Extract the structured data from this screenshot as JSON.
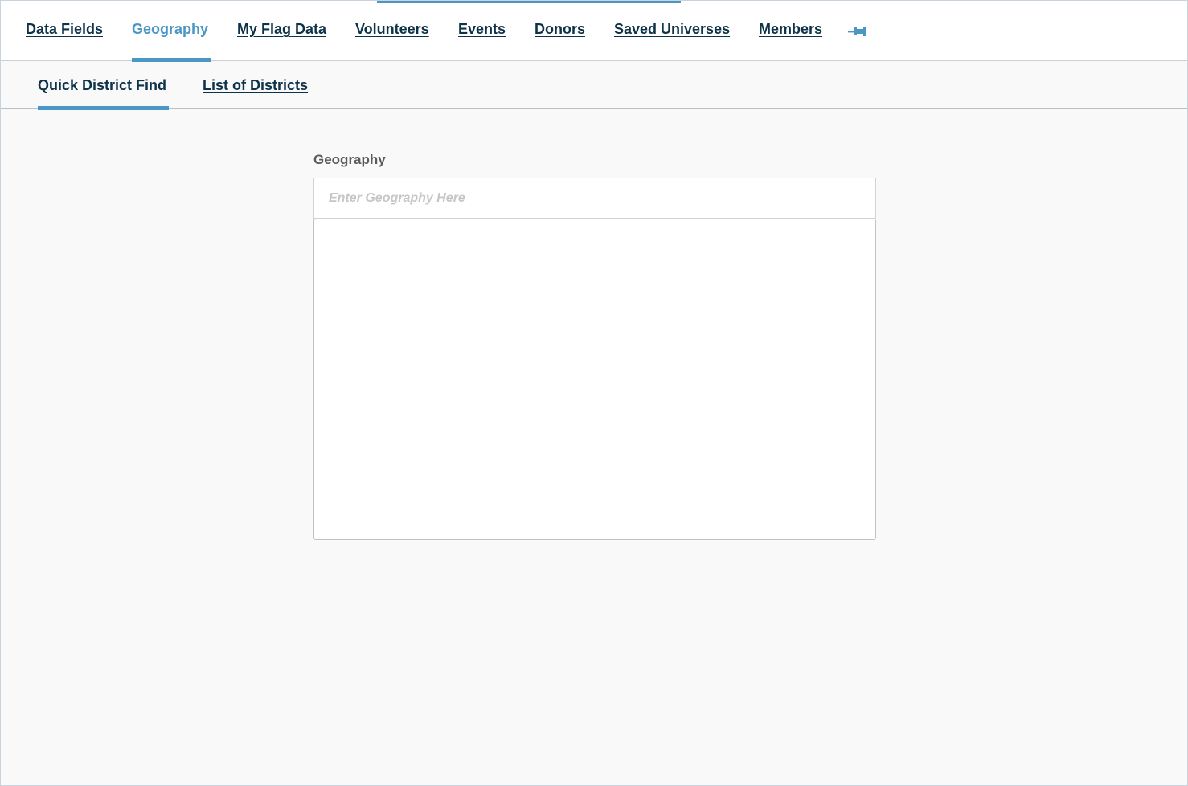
{
  "primary_nav": {
    "items": [
      {
        "label": "Data Fields"
      },
      {
        "label": "Geography"
      },
      {
        "label": "My Flag Data"
      },
      {
        "label": "Volunteers"
      },
      {
        "label": "Events"
      },
      {
        "label": "Donors"
      },
      {
        "label": "Saved Universes"
      },
      {
        "label": "Members"
      }
    ],
    "active": "Geography",
    "pin_icon": "pin-icon"
  },
  "secondary_nav": {
    "items": [
      {
        "label": "Quick District Find"
      },
      {
        "label": "List of Districts"
      }
    ],
    "active": "Quick District Find"
  },
  "form": {
    "geography_label": "Geography",
    "geography_placeholder": "Enter Geography Here",
    "geography_value": ""
  },
  "colors": {
    "accent": "#4a96c4",
    "nav_text": "#0d3349"
  }
}
